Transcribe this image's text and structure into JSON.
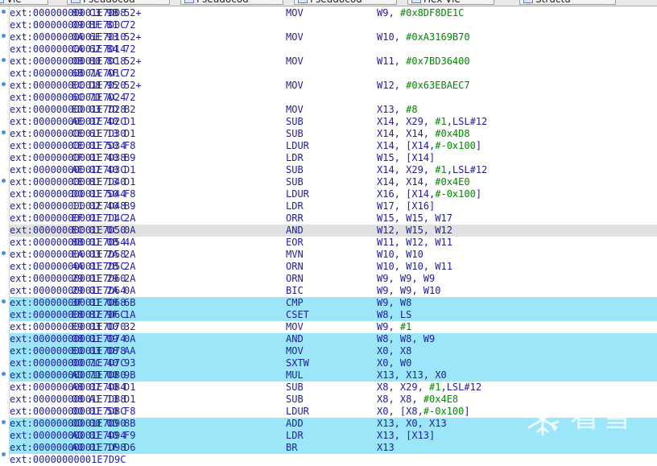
{
  "tabs": [
    {
      "label": "Vie",
      "has_close": true
    },
    {
      "label": "Pseudocod",
      "has_close": true
    },
    {
      "label": "Pseudocod",
      "has_close": true
    },
    {
      "label": "Pseudocod",
      "has_close": true
    },
    {
      "label": "Hex Vie",
      "has_close": true
    },
    {
      "label": "Structu",
      "has_close": true
    }
  ],
  "colors": {
    "address": "#1e1e9e",
    "number_literal": "#008800",
    "highlight_current": "#e1e1e1",
    "highlight_selected": "#9ce6fa",
    "gutter_marker": "#4a8fd6"
  },
  "rows": [
    {
      "addr": "ext:00000000001E7D08",
      "bytes": "89 C3 9B 52+",
      "mnem": "MOV",
      "ops": [
        {
          "t": "W9, "
        },
        {
          "t": "#0x8DF8DE1C",
          "n": true
        }
      ],
      "hl": ""
    },
    {
      "addr": "ext:00000000001E7D0C",
      "bytes": "09 BF B1 72",
      "mnem": "",
      "ops": [],
      "hl": ""
    },
    {
      "addr": "ext:00000000001E7D10",
      "bytes": "0A 6E 93 52+",
      "mnem": "MOV",
      "ops": [
        {
          "t": "W10, "
        },
        {
          "t": "#0xA3169B70",
          "n": true
        }
      ],
      "hl": ""
    },
    {
      "addr": "ext:00000000001E7D14",
      "bytes": "CA 62 B4 72",
      "mnem": "",
      "ops": [],
      "hl": ""
    },
    {
      "addr": "ext:00000000001E7D18",
      "bytes": "0B 80 8C 52+",
      "mnem": "MOV",
      "ops": [
        {
          "t": "W11, "
        },
        {
          "t": "#0x7BD36400",
          "n": true
        }
      ],
      "hl": ""
    },
    {
      "addr": "ext:00000000001E7D1C",
      "bytes": "6B 7A AF 72",
      "mnem": "",
      "ops": [],
      "hl": ""
    },
    {
      "addr": "ext:00000000001E7D20",
      "bytes": "EC D8 95 52+",
      "mnem": "MOV",
      "ops": [
        {
          "t": "W12, "
        },
        {
          "t": "#0x63EBAEC7",
          "n": true
        }
      ],
      "hl": ""
    },
    {
      "addr": "ext:00000000001E7D24",
      "bytes": "6C 7D AC 72",
      "mnem": "",
      "ops": [],
      "hl": ""
    },
    {
      "addr": "ext:00000000001E7D28",
      "bytes": "ED 03 7D B2",
      "mnem": "MOV",
      "ops": [
        {
          "t": "X13, "
        },
        {
          "t": "#8",
          "n": true
        }
      ],
      "hl": ""
    },
    {
      "addr": "ext:00000000001E7D2C",
      "bytes": "AE 07 40 D1",
      "mnem": "SUB",
      "ops": [
        {
          "t": "X14, X29, "
        },
        {
          "t": "#1",
          "n": true
        },
        {
          "t": ",LSL#12"
        }
      ],
      "hl": ""
    },
    {
      "addr": "ext:00000000001E7D30",
      "bytes": "CE 61 13 D1",
      "mnem": "SUB",
      "ops": [
        {
          "t": "X14, X14, "
        },
        {
          "t": "#0x4D8",
          "n": true
        }
      ],
      "hl": ""
    },
    {
      "addr": "ext:00000000001E7D34",
      "bytes": "CE 01 50 F8",
      "mnem": "LDUR",
      "ops": [
        {
          "t": "X14, [X14,"
        },
        {
          "t": "#-0x100",
          "n": true
        },
        {
          "t": "]"
        }
      ],
      "hl": ""
    },
    {
      "addr": "ext:00000000001E7D38",
      "bytes": "CF 01 40 B9",
      "mnem": "LDR",
      "ops": [
        {
          "t": "W15, [X14]"
        }
      ],
      "hl": ""
    },
    {
      "addr": "ext:00000000001E7D3C",
      "bytes": "AE 07 40 D1",
      "mnem": "SUB",
      "ops": [
        {
          "t": "X14, X29, "
        },
        {
          "t": "#1",
          "n": true
        },
        {
          "t": ",LSL#12"
        }
      ],
      "hl": ""
    },
    {
      "addr": "ext:00000000001E7D40",
      "bytes": "CE 81 13 D1",
      "mnem": "SUB",
      "ops": [
        {
          "t": "X14, X14, "
        },
        {
          "t": "#0x4E0",
          "n": true
        }
      ],
      "hl": ""
    },
    {
      "addr": "ext:00000000001E7D44",
      "bytes": "D0 01 50 F8",
      "mnem": "LDUR",
      "ops": [
        {
          "t": "X16, [X14,"
        },
        {
          "t": "#-0x100",
          "n": true
        },
        {
          "t": "]"
        }
      ],
      "hl": ""
    },
    {
      "addr": "ext:00000000001E7D48",
      "bytes": "11 02 40 B9",
      "mnem": "LDR",
      "ops": [
        {
          "t": "W17, [X16]"
        }
      ],
      "hl": ""
    },
    {
      "addr": "ext:00000000001E7D4C",
      "bytes": "EF 01 11 2A",
      "mnem": "ORR",
      "ops": [
        {
          "t": "W15, W15, W17"
        }
      ],
      "hl": ""
    },
    {
      "addr": "ext:00000000001E7D50",
      "bytes": "EC 01 0C 0A",
      "mnem": "AND",
      "ops": [
        {
          "t": "W12, W15, W12"
        }
      ],
      "hl": "gray"
    },
    {
      "addr": "ext:00000000001E7D54",
      "bytes": "8B 01 0B 4A",
      "mnem": "EOR",
      "ops": [
        {
          "t": "W11, W12, W11"
        }
      ],
      "hl": ""
    },
    {
      "addr": "ext:00000000001E7D58",
      "bytes": "EA 03 2A 2A",
      "mnem": "MVN",
      "ops": [
        {
          "t": "W10, W10"
        }
      ],
      "hl": ""
    },
    {
      "addr": "ext:00000000001E7D5C",
      "bytes": "4A 01 2B 2A",
      "mnem": "ORN",
      "ops": [
        {
          "t": "W10, W10, W11"
        }
      ],
      "hl": ""
    },
    {
      "addr": "ext:00000000001E7D60",
      "bytes": "29 01 29 2A",
      "mnem": "ORN",
      "ops": [
        {
          "t": "W9, W9, W9"
        }
      ],
      "hl": ""
    },
    {
      "addr": "ext:00000000001E7D64",
      "bytes": "29 01 2A 0A",
      "mnem": "BIC",
      "ops": [
        {
          "t": "W9, W9, W10"
        }
      ],
      "hl": ""
    },
    {
      "addr": "ext:00000000001E7D68",
      "bytes": "3F 01 08 6B",
      "mnem": "CMP",
      "ops": [
        {
          "t": "W9, W8"
        }
      ],
      "hl": "blue"
    },
    {
      "addr": "ext:00000000001E7D6C",
      "bytes": "E8 87 9F 1A",
      "mnem": "CSET",
      "ops": [
        {
          "t": "W8, LS"
        }
      ],
      "hl": "blue"
    },
    {
      "addr": "ext:00000000001E7D70",
      "bytes": "E9 03 00 32",
      "mnem": "MOV",
      "ops": [
        {
          "t": "W9, "
        },
        {
          "t": "#1",
          "n": true
        }
      ],
      "hl": ""
    },
    {
      "addr": "ext:00000000001E7D74",
      "bytes": "08 01 09 0A",
      "mnem": "AND",
      "ops": [
        {
          "t": "W8, W8, W9"
        }
      ],
      "hl": "blue"
    },
    {
      "addr": "ext:00000000001E7D78",
      "bytes": "E0 03 08 AA",
      "mnem": "MOV",
      "ops": [
        {
          "t": "X0, X8"
        }
      ],
      "hl": "blue"
    },
    {
      "addr": "ext:00000000001E7D7C",
      "bytes": "00 7C 40 93",
      "mnem": "SXTW",
      "ops": [
        {
          "t": "X0, W0"
        }
      ],
      "hl": "blue"
    },
    {
      "addr": "ext:00000000001E7D80",
      "bytes": "AD 7D 00 9B",
      "mnem": "MUL",
      "ops": [
        {
          "t": "X13, X13, X0"
        }
      ],
      "hl": "blue"
    },
    {
      "addr": "ext:00000000001E7D84",
      "bytes": "A8 07 40 D1",
      "mnem": "SUB",
      "ops": [
        {
          "t": "X8, X29, "
        },
        {
          "t": "#1",
          "n": true
        },
        {
          "t": ",LSL#12"
        }
      ],
      "hl": ""
    },
    {
      "addr": "ext:00000000001E7D88",
      "bytes": "08 A1 13 D1",
      "mnem": "SUB",
      "ops": [
        {
          "t": "X8, X8, "
        },
        {
          "t": "#0x4E8",
          "n": true
        }
      ],
      "hl": ""
    },
    {
      "addr": "ext:00000000001E7D8C",
      "bytes": "00 01 50 F8",
      "mnem": "LDUR",
      "ops": [
        {
          "t": "X0, [X8,"
        },
        {
          "t": "#-0x100",
          "n": true
        },
        {
          "t": "]"
        }
      ],
      "hl": ""
    },
    {
      "addr": "ext:00000000001E7D90",
      "bytes": "0D 00 0D 8B",
      "mnem": "ADD",
      "ops": [
        {
          "t": "X13, X0, X13"
        }
      ],
      "hl": "blue"
    },
    {
      "addr": "ext:00000000001E7D94",
      "bytes": "AD 01 40 F9",
      "mnem": "LDR",
      "ops": [
        {
          "t": "X13, [X13]"
        }
      ],
      "hl": "blue"
    },
    {
      "addr": "ext:00000000001E7D98",
      "bytes": "A0 01 1F D6",
      "mnem": "BR",
      "ops": [
        {
          "t": "X13"
        }
      ],
      "hl": "blue"
    },
    {
      "addr": "ext:00000000001E7D9C",
      "bytes": "",
      "mnem": "",
      "ops": [],
      "hl": "",
      "partial": true
    }
  ],
  "watermark": {
    "text": "看雪",
    "icon": "snowflake-icon"
  }
}
